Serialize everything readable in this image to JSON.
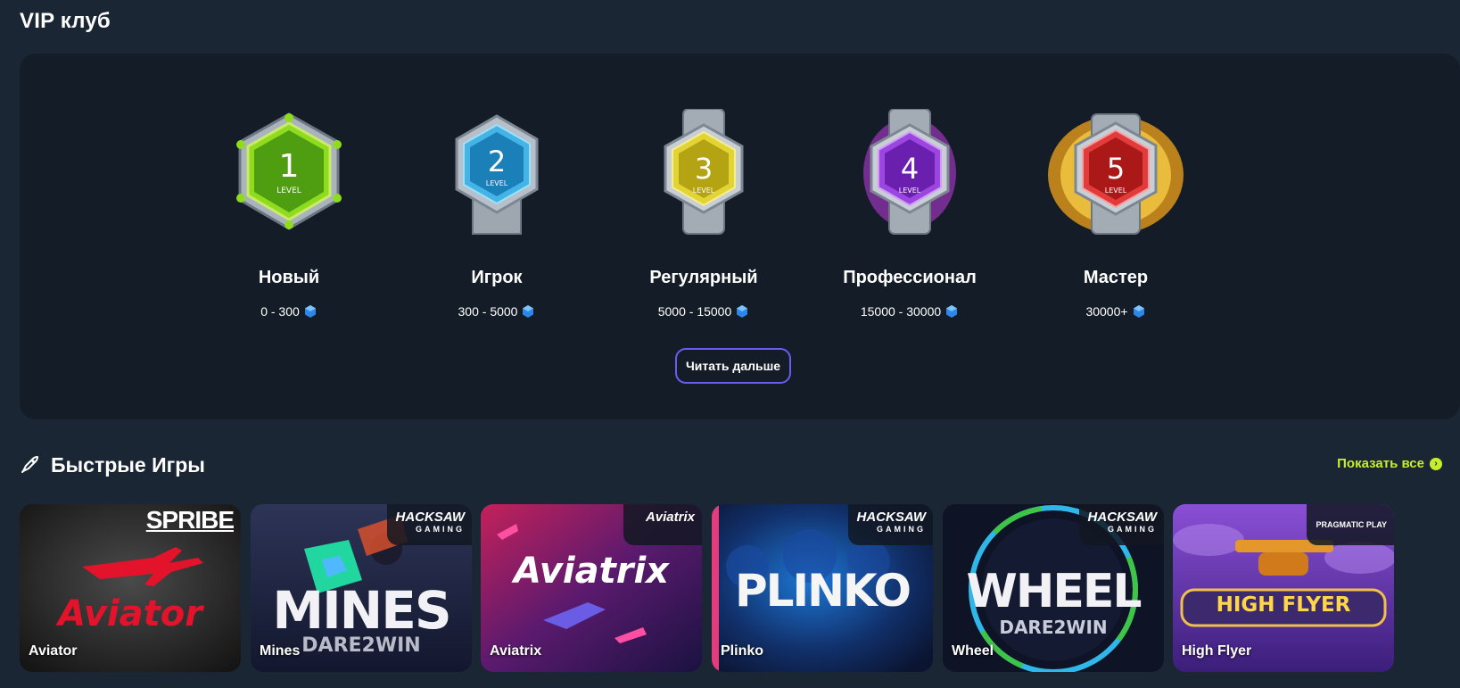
{
  "vip": {
    "title": "VIP клуб",
    "levels": [
      {
        "number": "1",
        "level_word": "LEVEL",
        "name": "Новый",
        "range": "0 - 300",
        "color": "#6cc41f"
      },
      {
        "number": "2",
        "level_word": "LEVEL",
        "name": "Игрок",
        "range": "300 - 5000",
        "color": "#2a9fd6"
      },
      {
        "number": "3",
        "level_word": "LEVEL",
        "name": "Регулярный",
        "range": "5000 - 15000",
        "color": "#d7c51d"
      },
      {
        "number": "4",
        "level_word": "LEVEL",
        "name": "Профессионал",
        "range": "15000 - 30000",
        "color": "#8a2bd6"
      },
      {
        "number": "5",
        "level_word": "LEVEL",
        "name": "Мастер",
        "range": "30000+",
        "color": "#d42a2a"
      }
    ],
    "read_more_label": "Читать дальше"
  },
  "quick_games": {
    "title": "Быстрые Игры",
    "show_all_label": "Показать все",
    "accent_color": "#c6ee2a",
    "games": [
      {
        "name": "Aviator",
        "provider": "SPRIBE",
        "logo_text": "Aviator"
      },
      {
        "name": "Mines",
        "provider": "HACKSAW",
        "provider_sub": "GAMING",
        "logo_text": "MINES",
        "logo_sub": "DARE2WIN"
      },
      {
        "name": "Aviatrix",
        "provider": "Aviatrix",
        "logo_text": "Aviatrix"
      },
      {
        "name": "Plinko",
        "provider": "HACKSAW",
        "provider_sub": "GAMING",
        "logo_text": "PLINKO"
      },
      {
        "name": "Wheel",
        "provider": "HACKSAW",
        "provider_sub": "GAMING",
        "logo_text": "WHEEL",
        "logo_sub": "DARE2WIN"
      },
      {
        "name": "High Flyer",
        "provider": "PRAGMATIC PLAY",
        "logo_text": "HIGH FLYER"
      }
    ]
  }
}
